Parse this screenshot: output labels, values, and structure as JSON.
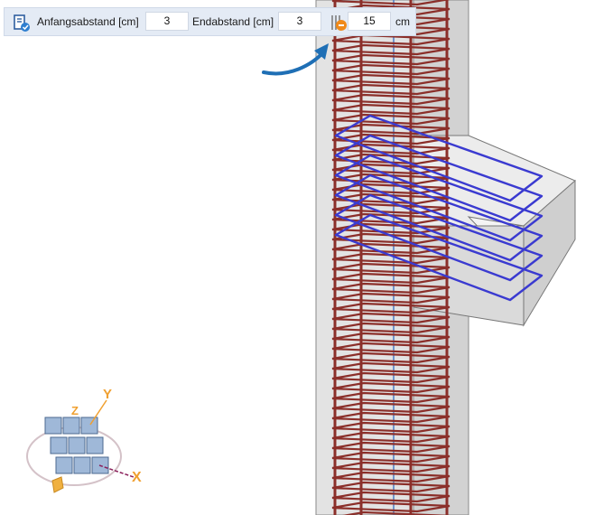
{
  "toolbar": {
    "start_distance_label": "Anfangsabstand [cm]",
    "start_distance_value": "3",
    "end_distance_label": "Endabstand [cm]",
    "end_distance_value": "3",
    "spacing_value": "15",
    "spacing_unit": "cm"
  },
  "navigator": {
    "axis_x_label": "X",
    "axis_y_label": "Y",
    "axis_z_label": "Z"
  },
  "colors": {
    "rebar_column": "#8b2f2a",
    "rebar_stirrup_blue": "#3a3ad0",
    "arrow": "#1f6fb5",
    "axis_orange": "#f0a030"
  }
}
